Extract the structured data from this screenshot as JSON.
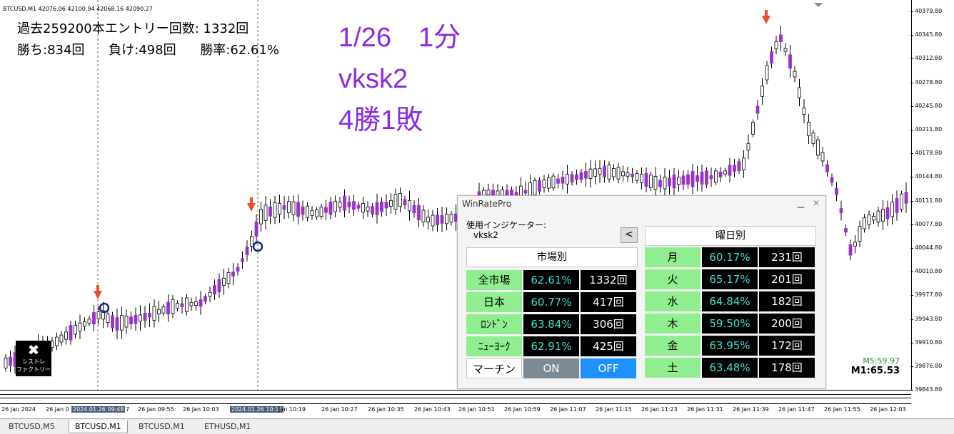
{
  "chart": {
    "symbol_info": "BTCUSD,M1  42076.06 42100.94 42068.16 42090.27",
    "stats_line1": "過去259200本エントリー回数: 1332回",
    "stats_wins": "勝ち:834回",
    "stats_losses": "負け:498回",
    "stats_rate": "勝率:62.61%",
    "note_line1": "1/26　1分",
    "note_line2": "vksk2",
    "note_line3": "4勝1敗",
    "logo_text_1": "シストレ",
    "logo_text_2": "ファクトリー",
    "timer_m5": "M5:59.97",
    "timer_m1": "M1:65.53",
    "colors": {
      "bull": "#ffffff",
      "bear": "#9932cc",
      "arrow": "#e8502c",
      "circle": "#1a237e",
      "note": "#8a2be2"
    }
  },
  "price_axis": [
    "40379.80",
    "40345.80",
    "40312.80",
    "40278.80",
    "40245.80",
    "40211.80",
    "40178.80",
    "40144.80",
    "40111.80",
    "40077.80",
    "40044.80",
    "40010.80",
    "39977.80",
    "39943.80",
    "39910.80",
    "39876.80",
    "39843.80"
  ],
  "time_axis": [
    {
      "label": "26 Jan 2024",
      "hl": false
    },
    {
      "label": "26 Jan 0",
      "hl": false
    },
    {
      "label": "2024.01.26 09:48",
      "hl": true
    },
    {
      "label": "7",
      "hl": false
    },
    {
      "label": "26 Jan 09:55",
      "hl": false
    },
    {
      "label": "26 Jan 10:03",
      "hl": false
    },
    {
      "label": "2024.01.26 10:16",
      "hl": true
    },
    {
      "label": "Jan 10:19",
      "hl": false
    },
    {
      "label": "26 Jan 10:27",
      "hl": false
    },
    {
      "label": "26 Jan 10:35",
      "hl": false
    },
    {
      "label": "26 Jan 10:43",
      "hl": false
    },
    {
      "label": "26 Jan 10:51",
      "hl": false
    },
    {
      "label": "26 Jan 10:59",
      "hl": false
    },
    {
      "label": "26 Jan 11:07",
      "hl": false
    },
    {
      "label": "26 Jan 11:15",
      "hl": false
    },
    {
      "label": "26 Jan 11:23",
      "hl": false
    },
    {
      "label": "26 Jan 11:31",
      "hl": false
    },
    {
      "label": "26 Jan 11:39",
      "hl": false
    },
    {
      "label": "26 Jan 11:47",
      "hl": false
    },
    {
      "label": "26 Jan 11:55",
      "hl": false
    },
    {
      "label": "26 Jan 12:03",
      "hl": false
    }
  ],
  "tabs": [
    "BTCUSD,M5",
    "BTCUSD,M1",
    "BTCUSD,M1",
    "ETHUSD,M1"
  ],
  "active_tab_index": 1,
  "winrate": {
    "title": "WinRatePro",
    "indicator_label": "使用インジケーター:",
    "indicator_name": "vksk2",
    "back_label": "<",
    "market_header": "市場別",
    "weekday_header": "曜日別",
    "markets": [
      {
        "name": "全市場",
        "pct": "62.61%",
        "count": "1332回"
      },
      {
        "name": "日本",
        "pct": "60.77%",
        "count": "417回"
      },
      {
        "name": "ﾛﾝﾄﾞﾝ",
        "pct": "63.84%",
        "count": "306回"
      },
      {
        "name": "ﾆｭｰﾖｰｸ",
        "pct": "62.91%",
        "count": "425回"
      }
    ],
    "martin_label": "マーチン",
    "on_label": "ON",
    "off_label": "OFF",
    "weekdays": [
      {
        "name": "月",
        "pct": "60.17%",
        "count": "231回"
      },
      {
        "name": "火",
        "pct": "65.17%",
        "count": "201回"
      },
      {
        "name": "水",
        "pct": "64.84%",
        "count": "182回"
      },
      {
        "name": "木",
        "pct": "59.50%",
        "count": "200回"
      },
      {
        "name": "金",
        "pct": "63.95%",
        "count": "172回"
      },
      {
        "name": "土",
        "pct": "63.48%",
        "count": "178回"
      }
    ]
  }
}
